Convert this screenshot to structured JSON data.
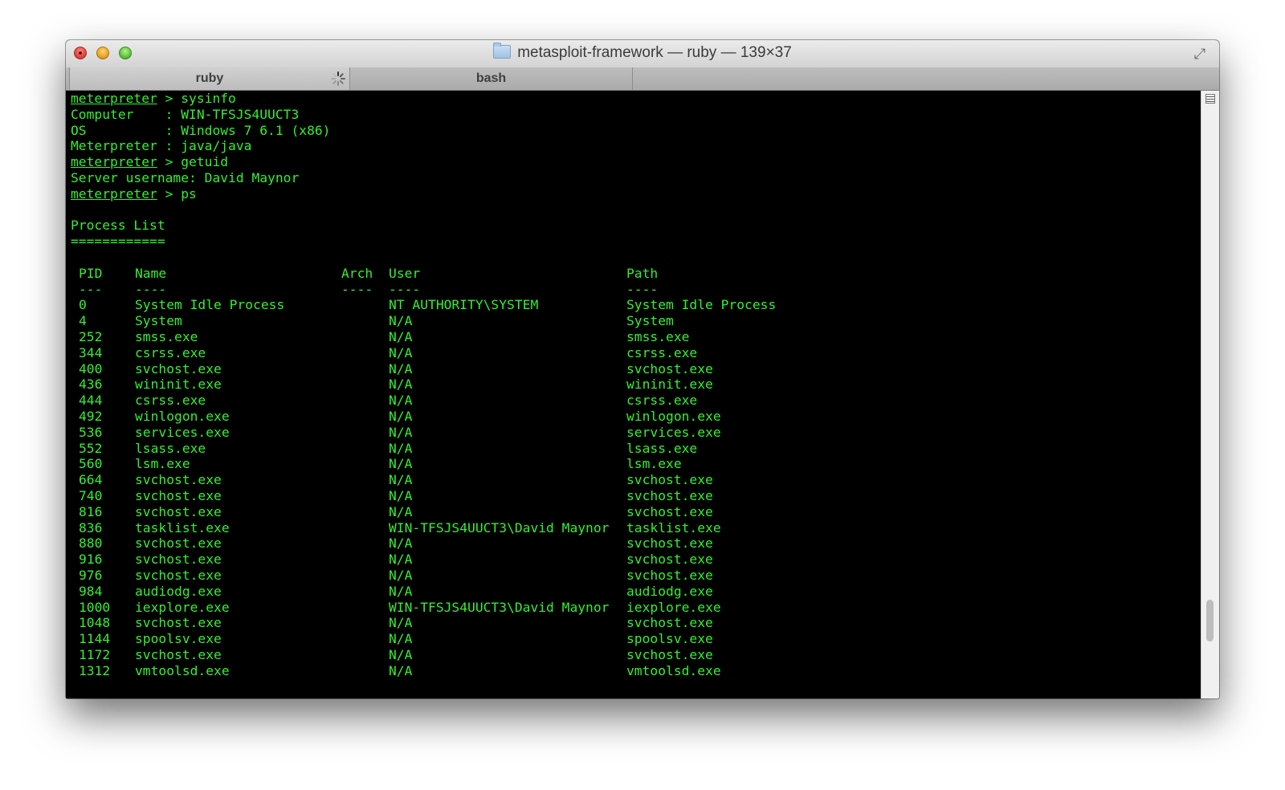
{
  "window": {
    "title": "metasploit-framework — ruby — 139×37"
  },
  "tabs": [
    {
      "label": "ruby",
      "busy": true
    },
    {
      "label": "bash",
      "busy": false
    }
  ],
  "session": [
    {
      "prompt": "meterpreter",
      "command": " > sysinfo"
    },
    {
      "text": "Computer    : WIN-TFSJS4UUCT3"
    },
    {
      "text": "OS          : Windows 7 6.1 (x86)"
    },
    {
      "text": "Meterpreter : java/java"
    },
    {
      "prompt": "meterpreter",
      "command": " > getuid"
    },
    {
      "text": "Server username: David Maynor"
    },
    {
      "prompt": "meterpreter",
      "command": " > ps"
    },
    {
      "text": ""
    },
    {
      "text": "Process List"
    },
    {
      "text": "============"
    },
    {
      "text": ""
    }
  ],
  "process_table": {
    "headers": {
      "pid": "PID",
      "name": "Name",
      "arch": "Arch",
      "user": "User",
      "path": "Path"
    },
    "underlines": {
      "pid": "---",
      "name": "----",
      "arch": "----",
      "user": "----",
      "path": "----"
    },
    "rows": [
      {
        "pid": "0",
        "name": "System Idle Process",
        "arch": "",
        "user": "NT AUTHORITY\\SYSTEM",
        "path": "System Idle Process"
      },
      {
        "pid": "4",
        "name": "System",
        "arch": "",
        "user": "N/A",
        "path": "System"
      },
      {
        "pid": "252",
        "name": "smss.exe",
        "arch": "",
        "user": "N/A",
        "path": "smss.exe"
      },
      {
        "pid": "344",
        "name": "csrss.exe",
        "arch": "",
        "user": "N/A",
        "path": "csrss.exe"
      },
      {
        "pid": "400",
        "name": "svchost.exe",
        "arch": "",
        "user": "N/A",
        "path": "svchost.exe"
      },
      {
        "pid": "436",
        "name": "wininit.exe",
        "arch": "",
        "user": "N/A",
        "path": "wininit.exe"
      },
      {
        "pid": "444",
        "name": "csrss.exe",
        "arch": "",
        "user": "N/A",
        "path": "csrss.exe"
      },
      {
        "pid": "492",
        "name": "winlogon.exe",
        "arch": "",
        "user": "N/A",
        "path": "winlogon.exe"
      },
      {
        "pid": "536",
        "name": "services.exe",
        "arch": "",
        "user": "N/A",
        "path": "services.exe"
      },
      {
        "pid": "552",
        "name": "lsass.exe",
        "arch": "",
        "user": "N/A",
        "path": "lsass.exe"
      },
      {
        "pid": "560",
        "name": "lsm.exe",
        "arch": "",
        "user": "N/A",
        "path": "lsm.exe"
      },
      {
        "pid": "664",
        "name": "svchost.exe",
        "arch": "",
        "user": "N/A",
        "path": "svchost.exe"
      },
      {
        "pid": "740",
        "name": "svchost.exe",
        "arch": "",
        "user": "N/A",
        "path": "svchost.exe"
      },
      {
        "pid": "816",
        "name": "svchost.exe",
        "arch": "",
        "user": "N/A",
        "path": "svchost.exe"
      },
      {
        "pid": "836",
        "name": "tasklist.exe",
        "arch": "",
        "user": "WIN-TFSJS4UUCT3\\David Maynor",
        "path": "tasklist.exe"
      },
      {
        "pid": "880",
        "name": "svchost.exe",
        "arch": "",
        "user": "N/A",
        "path": "svchost.exe"
      },
      {
        "pid": "916",
        "name": "svchost.exe",
        "arch": "",
        "user": "N/A",
        "path": "svchost.exe"
      },
      {
        "pid": "976",
        "name": "svchost.exe",
        "arch": "",
        "user": "N/A",
        "path": "svchost.exe"
      },
      {
        "pid": "984",
        "name": "audiodg.exe",
        "arch": "",
        "user": "N/A",
        "path": "audiodg.exe"
      },
      {
        "pid": "1000",
        "name": "iexplore.exe",
        "arch": "",
        "user": "WIN-TFSJS4UUCT3\\David Maynor",
        "path": "iexplore.exe"
      },
      {
        "pid": "1048",
        "name": "svchost.exe",
        "arch": "",
        "user": "N/A",
        "path": "svchost.exe"
      },
      {
        "pid": "1144",
        "name": "spoolsv.exe",
        "arch": "",
        "user": "N/A",
        "path": "spoolsv.exe"
      },
      {
        "pid": "1172",
        "name": "svchost.exe",
        "arch": "",
        "user": "N/A",
        "path": "svchost.exe"
      },
      {
        "pid": "1312",
        "name": "vmtoolsd.exe",
        "arch": "",
        "user": "N/A",
        "path": "vmtoolsd.exe"
      }
    ]
  },
  "scrollbar": {
    "position": 0.9
  },
  "colors": {
    "terminal_background": "#000000",
    "terminal_text": "#32f02e"
  },
  "icons": {
    "close": "close-icon",
    "minimize": "minimize-icon",
    "zoom": "zoom-icon",
    "folder": "folder-icon",
    "fullscreen": "fullscreen-icon",
    "spinner": "spinner-icon",
    "scroll_menu": "scroll-menu-icon"
  }
}
